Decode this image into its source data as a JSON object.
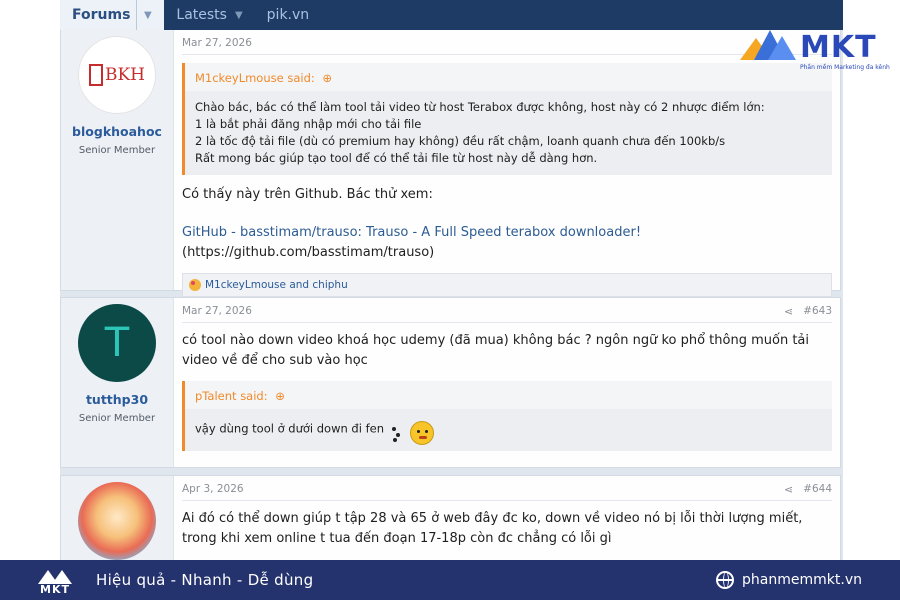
{
  "nav": {
    "tabs": [
      {
        "label": "Forums"
      },
      {
        "label": "Latests"
      },
      {
        "label": "pik.vn"
      }
    ]
  },
  "posts": [
    {
      "user": {
        "name": "blogkhoahoc",
        "title": "Senior Member",
        "avatar_text": "BKH"
      },
      "date": "Mar 27, 2026",
      "quote": {
        "author": "M1ckeyLmouse said:",
        "lines": [
          "Chào bác, bác có thể làm tool tải video từ host Terabox được không, host này có 2 nhược điểm lớn:",
          "1 là bắt phải đăng nhập mới cho tải file",
          "2 là tốc độ tải file (dù có premium hay không) đều rất chậm, loanh quanh chưa đến 100kb/s",
          "Rất mong bác giúp tạo tool để có thể tải file từ host này dễ dàng hơn."
        ]
      },
      "body": "Có thấy này trên Github. Bác thử xem:",
      "link_line1": "GitHub - basstimam/trauso: Trauso - A Full Speed terabox downloader!",
      "link_line2": "(https://github.com/basstimam/trauso)",
      "reactions": "M1ckeyLmouse and chiphu"
    },
    {
      "user": {
        "name": "tutthp30",
        "title": "Senior Member",
        "avatar_text": "T"
      },
      "date": "Mar 27, 2026",
      "number": "#643",
      "body": "có tool nào down video khoá học udemy (đã mua) không bác ? ngôn ngữ ko phổ thông muốn tải video về để cho sub vào học",
      "quote": {
        "author": "pTalent said:",
        "text": "vậy dùng tool ở dưới down đi fen"
      }
    },
    {
      "user": {
        "name": "",
        "title": ""
      },
      "date": "Apr 3, 2026",
      "number": "#644",
      "body": "Ai đó có thể down giúp t tập 28 và 65 ở web đây đc ko, down về video nó bị lỗi thời lượng miết, trong khi xem online t tua đến đoạn 17-18p còn đc chẳng có lỗi gì"
    }
  ],
  "watermark": {
    "brand": "MKT",
    "tagline": "Phần mềm Marketing đa kênh"
  },
  "banner": {
    "logo_text": "MKT",
    "slogan": "Hiệu quả - Nhanh - Dễ dùng",
    "site": "phanmemmkt.vn"
  },
  "icons": {
    "share": "share-icon",
    "quote_arrow": "expand-arrow-icon",
    "globe": "globe-icon"
  },
  "colors": {
    "nav_bg": "#1d3b64",
    "accent_orange": "#f08a2a",
    "link_blue": "#2c5c93",
    "banner_bg": "#24326d"
  }
}
